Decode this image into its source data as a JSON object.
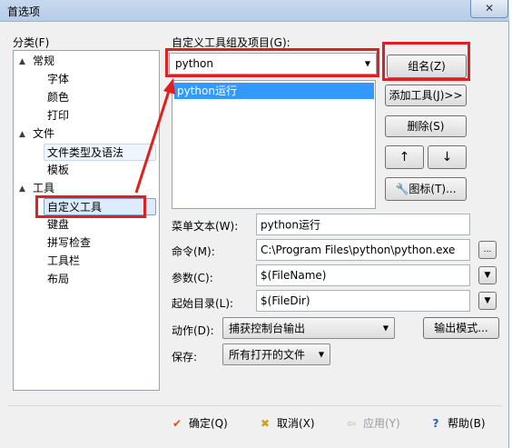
{
  "window": {
    "title": "首选项",
    "close_glyph": "✕"
  },
  "sidebar": {
    "label": "分类(F)",
    "items": [
      {
        "label": "常规",
        "toggle": "▲"
      },
      {
        "label": "字体"
      },
      {
        "label": "颜色"
      },
      {
        "label": "打印"
      },
      {
        "label": "文件",
        "toggle": "▲"
      },
      {
        "label": "文件类型及语法"
      },
      {
        "label": "模板"
      },
      {
        "label": "工具",
        "toggle": "▲"
      },
      {
        "label": "自定义工具"
      },
      {
        "label": "键盘"
      },
      {
        "label": "拼写检查"
      },
      {
        "label": "工具栏"
      },
      {
        "label": "布局"
      }
    ]
  },
  "tools": {
    "group_label": "自定义工具组及项目(G):",
    "group_value": "python",
    "list_items": [
      "python运行"
    ],
    "group_name_button": "组名(Z)",
    "add_tool_button": "添加工具(J)>>",
    "delete_button": "删除(S)",
    "up_glyph": "↑",
    "down_glyph": "↓",
    "icon_button": "图标(T)..."
  },
  "fields": {
    "menu_text_label": "菜单文本(W):",
    "menu_text_value": "python运行",
    "command_label": "命令(M):",
    "command_value": "C:\\Program Files\\python\\python.exe",
    "browse_label": "...",
    "args_label": "参数(C):",
    "args_value": "$(FileName)",
    "startdir_label": "起始目录(L):",
    "startdir_value": "$(FileDir)",
    "action_label": "动作(D):",
    "action_value": "捕获控制台输出",
    "output_mode_button": "输出模式...",
    "save_label": "保存:",
    "save_value": "所有打开的文件"
  },
  "footer": {
    "ok": "确定(Q)",
    "cancel": "取消(X)",
    "apply": "应用(Y)",
    "help": "帮助(B)"
  },
  "colors": {
    "accent": "#3399ff",
    "annotation_red": "#e02020",
    "ok_icon": "#e05010",
    "cancel_icon": "#d0a020",
    "help_icon": "#2060c0"
  }
}
